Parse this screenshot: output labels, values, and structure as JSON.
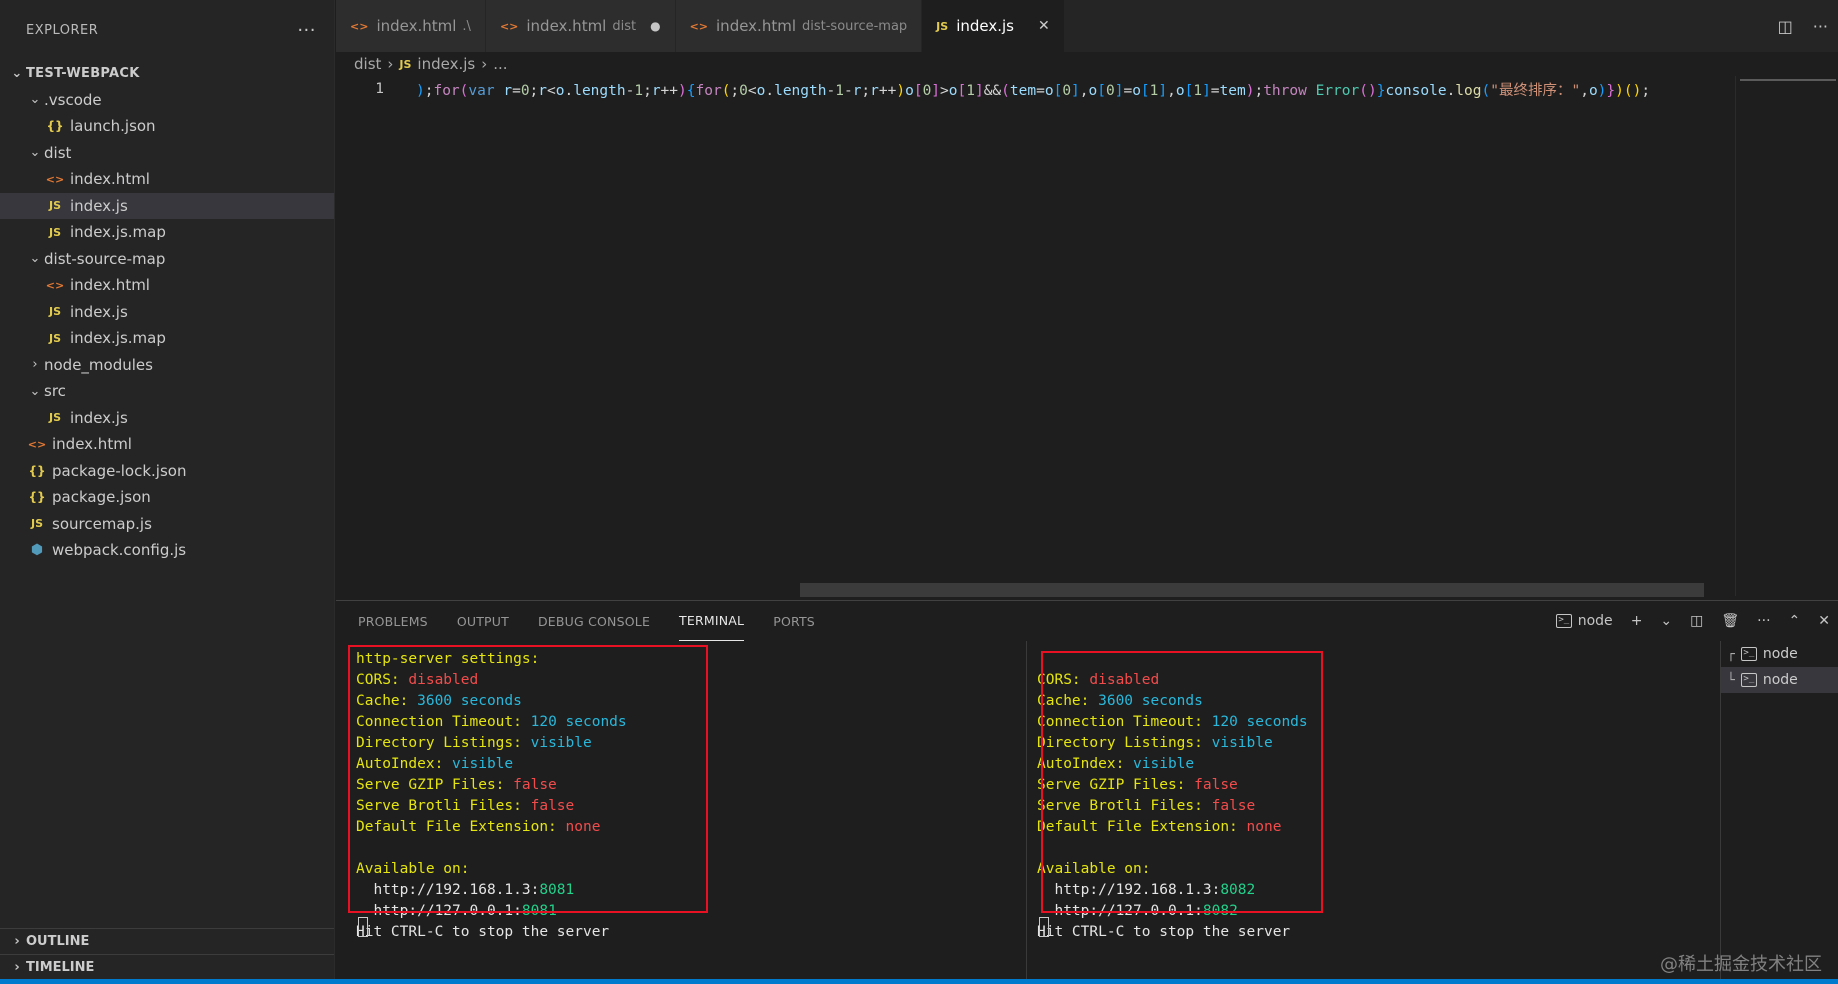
{
  "explorer": {
    "title": "EXPLORER",
    "more": "···",
    "root": "TEST-WEBPACK",
    "items": [
      {
        "label": ".vscode",
        "kind": "folder",
        "icon": "",
        "open": "⌄",
        "indent": 1
      },
      {
        "label": "launch.json",
        "kind": "json",
        "icon": "{}",
        "indent": 2
      },
      {
        "label": "dist",
        "kind": "folder",
        "icon": "",
        "open": "⌄",
        "indent": 1
      },
      {
        "label": "index.html",
        "kind": "html",
        "icon": "<>",
        "indent": 2
      },
      {
        "label": "index.js",
        "kind": "js",
        "icon": "JS",
        "indent": 2,
        "active": true
      },
      {
        "label": "index.js.map",
        "kind": "js",
        "icon": "JS",
        "indent": 2
      },
      {
        "label": "dist-source-map",
        "kind": "folder",
        "icon": "",
        "open": "⌄",
        "indent": 1
      },
      {
        "label": "index.html",
        "kind": "html",
        "icon": "<>",
        "indent": 2
      },
      {
        "label": "index.js",
        "kind": "js",
        "icon": "JS",
        "indent": 2
      },
      {
        "label": "index.js.map",
        "kind": "js",
        "icon": "JS",
        "indent": 2
      },
      {
        "label": "node_modules",
        "kind": "folder",
        "icon": "",
        "open": "›",
        "indent": 1
      },
      {
        "label": "src",
        "kind": "folder",
        "icon": "",
        "open": "⌄",
        "indent": 1
      },
      {
        "label": "index.js",
        "kind": "js",
        "icon": "JS",
        "indent": 2
      },
      {
        "label": "index.html",
        "kind": "html",
        "icon": "<>",
        "indent": 1
      },
      {
        "label": "package-lock.json",
        "kind": "json",
        "icon": "{}",
        "indent": 1
      },
      {
        "label": "package.json",
        "kind": "json",
        "icon": "{}",
        "indent": 1
      },
      {
        "label": "sourcemap.js",
        "kind": "js",
        "icon": "JS",
        "indent": 1
      },
      {
        "label": "webpack.config.js",
        "kind": "wp",
        "icon": "⬢",
        "indent": 1
      }
    ],
    "outline": "OUTLINE",
    "timeline": "TIMELINE"
  },
  "tabs": [
    {
      "label": "index.html",
      "desc": ".\\",
      "icon": "<>",
      "kind": "html"
    },
    {
      "label": "index.html",
      "desc": "dist",
      "icon": "<>",
      "kind": "html",
      "modified": "●"
    },
    {
      "label": "index.html",
      "desc": "dist-source-map",
      "icon": "<>",
      "kind": "html"
    },
    {
      "label": "index.js",
      "desc": "",
      "icon": "JS",
      "kind": "js",
      "active": true,
      "close": "✕"
    }
  ],
  "breadcrumb": {
    "folder": "dist",
    "sep": "›",
    "file_icon": "JS",
    "file": "index.js",
    "more": "..."
  },
  "editor": {
    "line_number": "1",
    "code_tokens": [
      [
        "br3",
        ")"
      ],
      [
        "plain",
        ";"
      ],
      [
        "kw2",
        "for"
      ],
      [
        "br2",
        "("
      ],
      [
        "kw",
        "var"
      ],
      [
        "plain",
        " "
      ],
      [
        "var",
        "r"
      ],
      [
        "plain",
        "="
      ],
      [
        "num",
        "0"
      ],
      [
        "plain",
        ";"
      ],
      [
        "var",
        "r"
      ],
      [
        "plain",
        "<"
      ],
      [
        "var",
        "o"
      ],
      [
        "plain",
        "."
      ],
      [
        "var",
        "length"
      ],
      [
        "plain",
        "-"
      ],
      [
        "num",
        "1"
      ],
      [
        "plain",
        ";"
      ],
      [
        "var",
        "r"
      ],
      [
        "plain",
        "++"
      ],
      [
        "br2",
        ")"
      ],
      [
        "br3",
        "{"
      ],
      [
        "kw2",
        "for"
      ],
      [
        "br1",
        "("
      ],
      [
        "plain",
        ";"
      ],
      [
        "num",
        "0"
      ],
      [
        "plain",
        "<"
      ],
      [
        "var",
        "o"
      ],
      [
        "plain",
        "."
      ],
      [
        "var",
        "length"
      ],
      [
        "plain",
        "-"
      ],
      [
        "num",
        "1"
      ],
      [
        "plain",
        "-"
      ],
      [
        "var",
        "r"
      ],
      [
        "plain",
        ";"
      ],
      [
        "var",
        "r"
      ],
      [
        "plain",
        "++"
      ],
      [
        "br1",
        ")"
      ],
      [
        "var",
        "o"
      ],
      [
        "br2",
        "["
      ],
      [
        "num",
        "0"
      ],
      [
        "br2",
        "]"
      ],
      [
        "plain",
        ">"
      ],
      [
        "var",
        "o"
      ],
      [
        "br2",
        "["
      ],
      [
        "num",
        "1"
      ],
      [
        "br2",
        "]"
      ],
      [
        "plain",
        "&&"
      ],
      [
        "br2",
        "("
      ],
      [
        "var",
        "tem"
      ],
      [
        "plain",
        "="
      ],
      [
        "var",
        "o"
      ],
      [
        "br3",
        "["
      ],
      [
        "num",
        "0"
      ],
      [
        "br3",
        "]"
      ],
      [
        "plain",
        ","
      ],
      [
        "var",
        "o"
      ],
      [
        "br3",
        "["
      ],
      [
        "num",
        "0"
      ],
      [
        "br3",
        "]"
      ],
      [
        "plain",
        "="
      ],
      [
        "var",
        "o"
      ],
      [
        "br3",
        "["
      ],
      [
        "num",
        "1"
      ],
      [
        "br3",
        "]"
      ],
      [
        "plain",
        ","
      ],
      [
        "var",
        "o"
      ],
      [
        "br3",
        "["
      ],
      [
        "num",
        "1"
      ],
      [
        "br3",
        "]"
      ],
      [
        "plain",
        "="
      ],
      [
        "var",
        "tem"
      ],
      [
        "br2",
        ")"
      ],
      [
        "plain",
        ";"
      ],
      [
        "kw2",
        "throw"
      ],
      [
        "plain",
        " "
      ],
      [
        "cls",
        "Error"
      ],
      [
        "br2",
        "()"
      ],
      [
        "br3",
        "}"
      ],
      [
        "var",
        "console"
      ],
      [
        "plain",
        "."
      ],
      [
        "fn",
        "log"
      ],
      [
        "br3",
        "("
      ],
      [
        "str",
        "\"最终排序：\""
      ],
      [
        "plain",
        ","
      ],
      [
        "var",
        "o"
      ],
      [
        "br3",
        ")"
      ],
      [
        "br2",
        "}"
      ],
      [
        "br1",
        ")"
      ],
      [
        "br1",
        "()"
      ],
      [
        "plain",
        ";"
      ]
    ]
  },
  "panel": {
    "tabs": [
      "PROBLEMS",
      "OUTPUT",
      "DEBUG CONSOLE",
      "TERMINAL",
      "PORTS"
    ],
    "active_tab": 3,
    "terminal_name": "node",
    "actions": {
      "add": "+",
      "dropdown": "⌄",
      "split": "◫",
      "trash": "🗑",
      "more": "···",
      "maximize": "⌃",
      "close": "✕"
    },
    "terminal_list": [
      {
        "branch": "┌",
        "label": "node"
      },
      {
        "branch": "└",
        "label": "node",
        "active": true
      }
    ]
  },
  "terminal_left": {
    "header": "http-server settings:",
    "settings": [
      {
        "key": "CORS: ",
        "value": "disabled",
        "color": "red"
      },
      {
        "key": "Cache: ",
        "value": "3600 seconds",
        "color": "cyan"
      },
      {
        "key": "Connection Timeout: ",
        "value": "120 seconds",
        "color": "cyan"
      },
      {
        "key": "Directory Listings: ",
        "value": "visible",
        "color": "cyan"
      },
      {
        "key": "AutoIndex: ",
        "value": "visible",
        "color": "cyan"
      },
      {
        "key": "Serve GZIP Files: ",
        "value": "false",
        "color": "red"
      },
      {
        "key": "Serve Brotli Files: ",
        "value": "false",
        "color": "red"
      },
      {
        "key": "Default File Extension: ",
        "value": "none",
        "color": "red"
      }
    ],
    "available": "Available on:",
    "urls": [
      {
        "host": "  http://192.168.1.3:",
        "port": "8081"
      },
      {
        "host": "  http://127.0.0.1:",
        "port": "8081"
      }
    ],
    "hint": "Hit CTRL-C to stop the server"
  },
  "terminal_right": {
    "header": "",
    "settings": [
      {
        "key": "CORS: ",
        "value": "disabled",
        "color": "red"
      },
      {
        "key": "Cache: ",
        "value": "3600 seconds",
        "color": "cyan"
      },
      {
        "key": "Connection Timeout: ",
        "value": "120 seconds",
        "color": "cyan"
      },
      {
        "key": "Directory Listings: ",
        "value": "visible",
        "color": "cyan"
      },
      {
        "key": "AutoIndex: ",
        "value": "visible",
        "color": "cyan"
      },
      {
        "key": "Serve GZIP Files: ",
        "value": "false",
        "color": "red"
      },
      {
        "key": "Serve Brotli Files: ",
        "value": "false",
        "color": "red"
      },
      {
        "key": "Default File Extension: ",
        "value": "none",
        "color": "red"
      }
    ],
    "available": "Available on:",
    "urls": [
      {
        "host": "  http://192.168.1.3:",
        "port": "8082"
      },
      {
        "host": "  http://127.0.0.1:",
        "port": "8082"
      }
    ],
    "hint": "Hit CTRL-C to stop the server"
  },
  "watermark": "@稀土掘金技术社区",
  "colors": {
    "accent": "#007acc",
    "highlight_box": "#e81123"
  }
}
